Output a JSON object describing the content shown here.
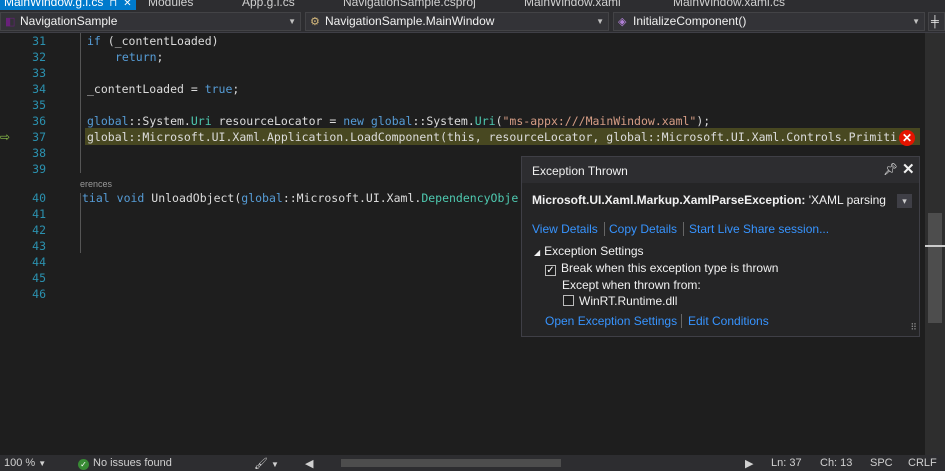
{
  "tabs": [
    {
      "label": "MainWindow.g.i.cs",
      "active": true
    },
    {
      "label": "Modules",
      "active": false
    },
    {
      "label": "App.g.i.cs",
      "active": false
    },
    {
      "label": "NavigationSample.csproj",
      "active": false
    },
    {
      "label": "MainWindow.xaml",
      "active": false
    },
    {
      "label": "MainWindow.xaml.cs",
      "active": false
    }
  ],
  "navbar": {
    "project": "NavigationSample",
    "type": "NavigationSample.MainWindow",
    "member": "InitializeComponent()"
  },
  "editor": {
    "line_numbers": [
      "31",
      "32",
      "33",
      "34",
      "35",
      "36",
      "37",
      "38",
      "39",
      "40",
      "41",
      "42",
      "43",
      "44",
      "45",
      "46"
    ],
    "references_label": "erences",
    "code": {
      "l31_kw": "if",
      "l31_rest": " (_contentLoaded)",
      "l32": "return",
      "l32_tail": ";",
      "l34_a": "_contentLoaded = ",
      "l34_kw": "true",
      "l34_b": ";",
      "l36_a": "global",
      "l36_b": "::System.",
      "l36_c": "Uri",
      "l36_d": " resourceLocator = ",
      "l36_e": "new",
      "l36_f": " ",
      "l36_g": "global",
      "l36_h": "::System.",
      "l36_i": "Uri",
      "l36_j": "(",
      "l36_k": "\"ms-appx:///MainWindow.xaml\"",
      "l36_l": ");",
      "l37": "global::Microsoft.UI.Xaml.Application.LoadComponent(this, resourceLocator, global::Microsoft.UI.Xaml.Controls.Primiti",
      "l40_a": "tial",
      "l40_b": " ",
      "l40_c": "void",
      "l40_d": " UnloadObject(",
      "l40_e": "global",
      "l40_f": "::Microsoft.UI.Xaml.",
      "l40_g": "DependencyObje"
    }
  },
  "exception_popup": {
    "title": "Exception Thrown",
    "exception_type": "Microsoft.UI.Xaml.Markup.XamlParseException:",
    "message": " 'XAML parsing",
    "links": {
      "view_details": "View Details",
      "copy_details": "Copy Details",
      "live_share": "Start Live Share session..."
    },
    "settings_header": "Exception Settings",
    "break_when_thrown": "Break when this exception type is thrown",
    "break_checked": true,
    "except_when_thrown_from": "Except when thrown from:",
    "winrt_module": "WinRT.Runtime.dll",
    "winrt_checked": false,
    "open_settings": "Open Exception Settings",
    "edit_conditions": "Edit Conditions"
  },
  "statusbar": {
    "zoom": "100 %",
    "issues": "No issues found",
    "line": "Ln: 37",
    "col": "Ch: 13",
    "whitespace": "SPC",
    "line_ending": "CRLF"
  },
  "colors": {
    "accent": "#007acc",
    "error": "#e51400",
    "link": "#3794ff",
    "keyword": "#569cd6",
    "type": "#4ec9b0",
    "string": "#d69d85",
    "line_number": "#2b91af"
  }
}
